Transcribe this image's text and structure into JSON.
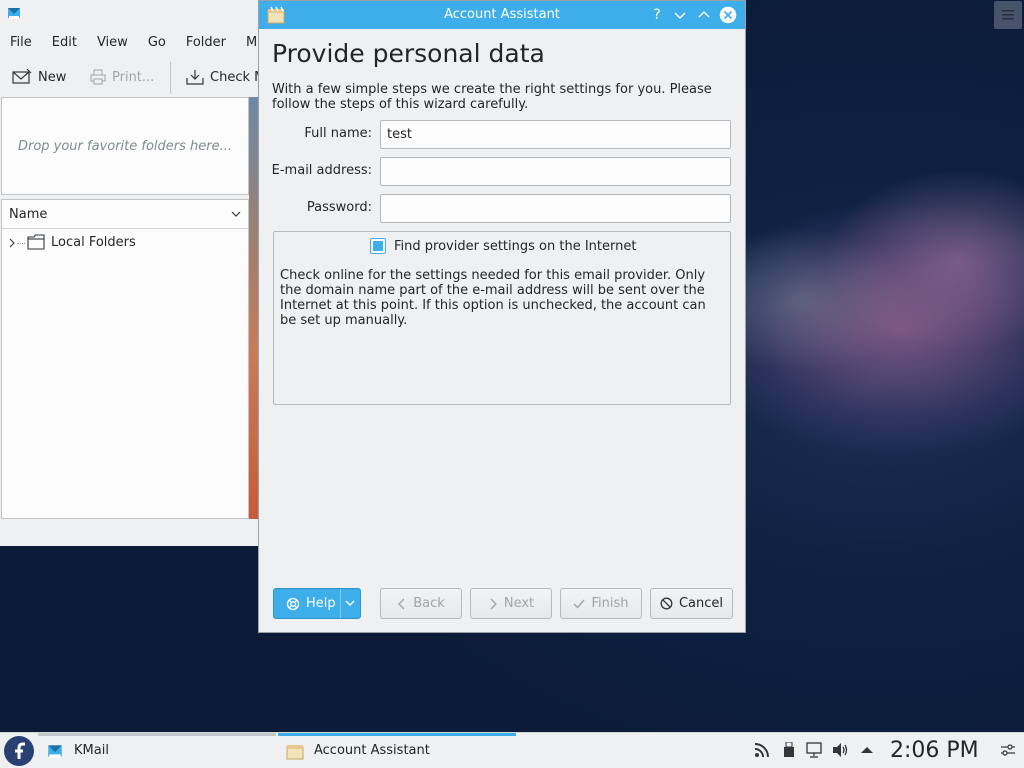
{
  "kmail": {
    "menus": [
      "File",
      "Edit",
      "View",
      "Go",
      "Folder",
      "M"
    ],
    "toolbar": {
      "new": "New",
      "print": "Print...",
      "check": "Check M"
    },
    "favorites_hint": "Drop your favorite folders here...",
    "folder_header": "Name",
    "folders": [
      "Local Folders"
    ]
  },
  "dialog": {
    "title": "Account Assistant",
    "heading": "Provide personal data",
    "intro": "With a few simple steps we create the right settings for you. Please follow the steps of this wizard carefully.",
    "fields": {
      "full_name": {
        "label": "Full name:",
        "value": "test"
      },
      "email": {
        "label": "E-mail address:",
        "value": ""
      },
      "password": {
        "label": "Password:",
        "value": ""
      }
    },
    "provider": {
      "checkbox_label": "Find provider settings on the Internet",
      "checked": true,
      "description": "Check online for the settings needed for this email provider. Only the domain name part of the e-mail address will be sent over the Internet at this point. If this option is unchecked, the account can be set up manually."
    },
    "buttons": {
      "help": "Help",
      "back": "Back",
      "next": "Next",
      "finish": "Finish",
      "cancel": "Cancel"
    }
  },
  "taskbar": {
    "tasks": [
      "KMail",
      "Account Assistant"
    ],
    "clock": "2:06 PM"
  },
  "colors": {
    "accent": "#3daee9",
    "window_bg": "#eff0f1",
    "text": "#232629"
  },
  "icons": [
    "kmail-icon",
    "hamburger-icon",
    "new-mail-icon",
    "print-icon",
    "check-mail-icon",
    "folder-icon",
    "help-icon",
    "chevron-left-icon",
    "chevron-right-icon",
    "check-icon",
    "cancel-icon",
    "fedora-icon",
    "rss-icon",
    "usb-icon",
    "network-icon",
    "volume-icon",
    "arrow-up-icon",
    "settings-icon"
  ]
}
